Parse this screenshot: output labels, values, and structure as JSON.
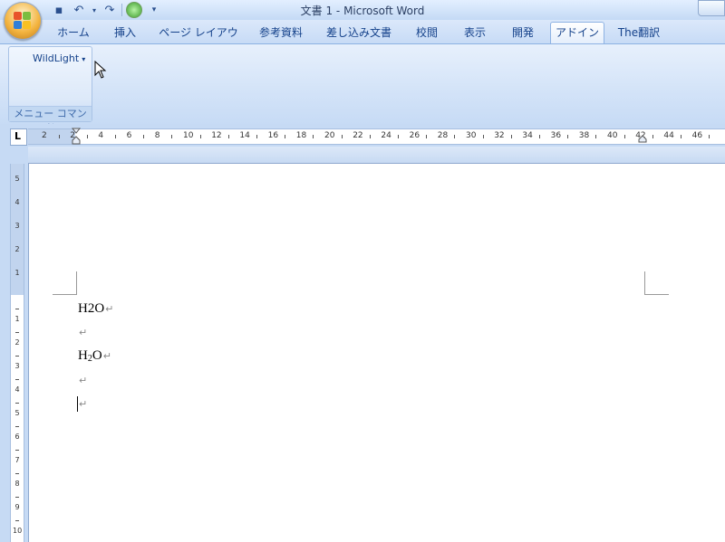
{
  "window": {
    "title": "文書 1 - Microsoft Word"
  },
  "quick_access": {
    "icons": [
      "save-icon",
      "undo-icon",
      "redo-icon",
      "green-circle-icon",
      "customize-dropdown-icon"
    ],
    "undo_glyph": "↶",
    "redo_glyph": "↷",
    "dropdown_glyph": "▾",
    "save_glyph": "▪"
  },
  "tabs": [
    {
      "label": "ホーム"
    },
    {
      "label": "挿入"
    },
    {
      "label": "ページ レイアウト"
    },
    {
      "label": "参考資料"
    },
    {
      "label": "差し込み文書"
    },
    {
      "label": "校閲"
    },
    {
      "label": "表示"
    },
    {
      "label": "開発"
    },
    {
      "label": "アドイン",
      "active": true
    },
    {
      "label": "The翻訳"
    }
  ],
  "ribbon": {
    "group_label": "メニュー コマンド",
    "dropdown_label": "WildLight",
    "dropdown_arrow": "▾"
  },
  "ruler": {
    "horizontal_numbers": [
      "2",
      "2",
      "4",
      "6",
      "8",
      "10",
      "12",
      "14",
      "16",
      "18",
      "20",
      "22",
      "24",
      "26",
      "28",
      "30",
      "32",
      "34",
      "36",
      "38",
      "40",
      "42",
      "44",
      "46"
    ],
    "vertical_numbers_top": [
      "5",
      "4",
      "3",
      "2",
      "1"
    ],
    "vertical_numbers_body": [
      "1",
      "2",
      "3",
      "4",
      "5",
      "6",
      "7",
      "8",
      "9",
      "10"
    ],
    "tab_selector_glyph": "L"
  },
  "document": {
    "paragraphs": [
      {
        "text": "H2O",
        "mark": "↵"
      },
      {
        "text": "",
        "mark": "↵"
      },
      {
        "pre": "H",
        "sub": "2",
        "post": "O",
        "mark": "↵"
      },
      {
        "text": "",
        "mark": "↵"
      },
      {
        "text": "",
        "mark": "↵"
      }
    ]
  },
  "colors": {
    "accent": "#15428b",
    "ribbon": "#d3e3f8",
    "page": "#ffffff"
  }
}
